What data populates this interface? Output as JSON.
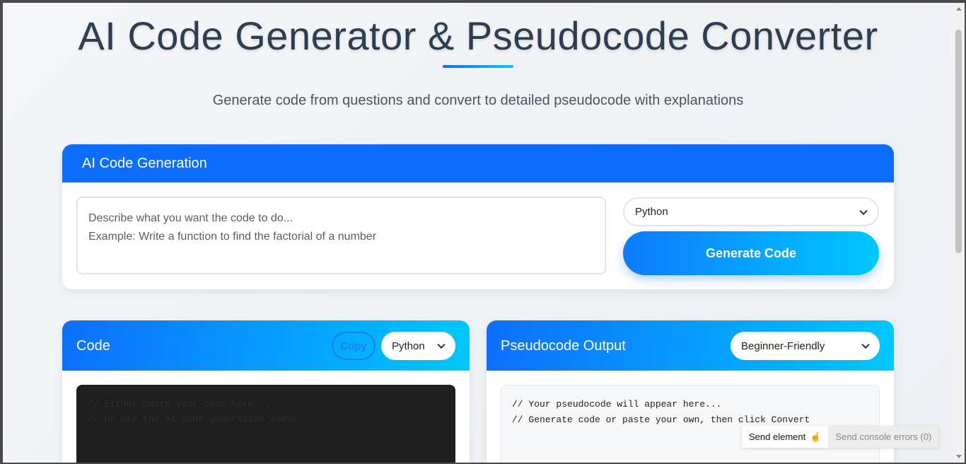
{
  "page": {
    "title": "AI Code Generator & Pseudocode Converter",
    "subtitle": "Generate code from questions and convert to detailed pseudocode with explanations"
  },
  "generation": {
    "header": "AI Code Generation",
    "prompt_placeholder": "Describe what you want the code to do...\nExample: Write a function to find the factorial of a number",
    "language_selected": "Python",
    "generate_label": "Generate Code"
  },
  "code_panel": {
    "title": "Code",
    "copy_label": "Copy",
    "language_selected": "Python",
    "placeholder": "// Either paste your code here...\n// Or use the AI code generation above"
  },
  "pseudo_panel": {
    "title": "Pseudocode Output",
    "level_selected": "Beginner-Friendly",
    "placeholder": "// Your pseudocode will appear here...\n// Generate code or paste your own, then click Convert"
  },
  "devtools": {
    "send_element_label": "Send element",
    "send_console_label": "Send console errors (0)",
    "cursor_icon": "pointer-hand-icon"
  },
  "colors": {
    "primary": "#0d6efd",
    "accent": "#00c8ff",
    "title": "#2c3e50"
  }
}
